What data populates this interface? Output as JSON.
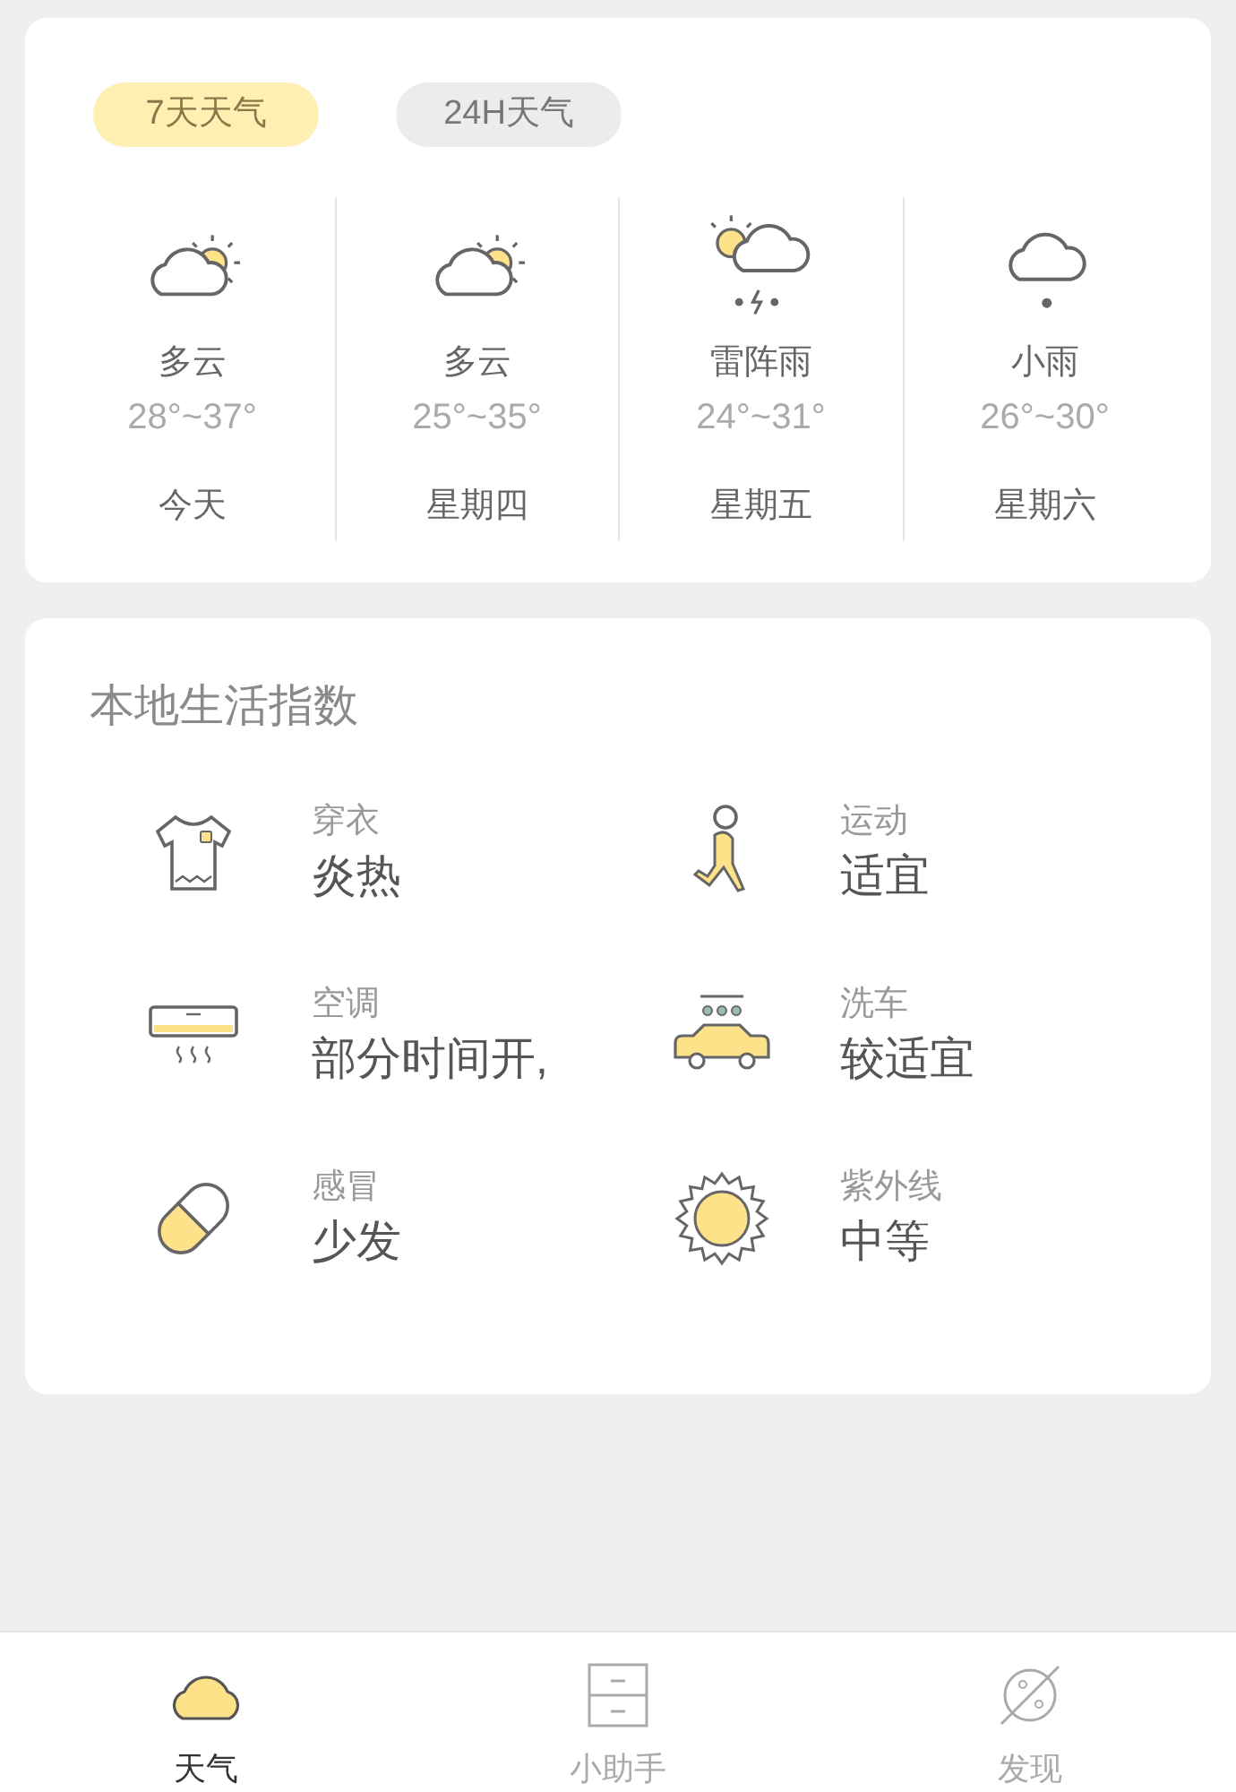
{
  "forecast_tabs": [
    {
      "label": "7天天气",
      "selected": true
    },
    {
      "label": "24H天气",
      "selected": false
    }
  ],
  "forecast": [
    {
      "kind": "partly-cloudy",
      "condition": "多云",
      "temperature": "28°~37°",
      "day": "今天"
    },
    {
      "kind": "partly-cloudy",
      "condition": "多云",
      "temperature": "25°~35°",
      "day": "星期四"
    },
    {
      "kind": "thunder-shower",
      "condition": "雷阵雨",
      "temperature": "24°~31°",
      "day": "星期五"
    },
    {
      "kind": "light-rain",
      "condition": "小雨",
      "temperature": "26°~30°",
      "day": "星期六"
    }
  ],
  "life_index": {
    "title": "本地生活指数",
    "items": [
      {
        "kind": "clothing",
        "label": "穿衣",
        "value": "炎热"
      },
      {
        "kind": "sport",
        "label": "运动",
        "value": "适宜"
      },
      {
        "kind": "aircon",
        "label": "空调",
        "value": "部分时间开,"
      },
      {
        "kind": "carwash",
        "label": "洗车",
        "value": "较适宜"
      },
      {
        "kind": "cold",
        "label": "感冒",
        "value": "少发"
      },
      {
        "kind": "uv",
        "label": "紫外线",
        "value": "中等"
      }
    ]
  },
  "bottom_nav": [
    {
      "kind": "weather",
      "label": "天气",
      "selected": true
    },
    {
      "kind": "assistant",
      "label": "小助手",
      "selected": false
    },
    {
      "kind": "discover",
      "label": "发现",
      "selected": false
    }
  ]
}
